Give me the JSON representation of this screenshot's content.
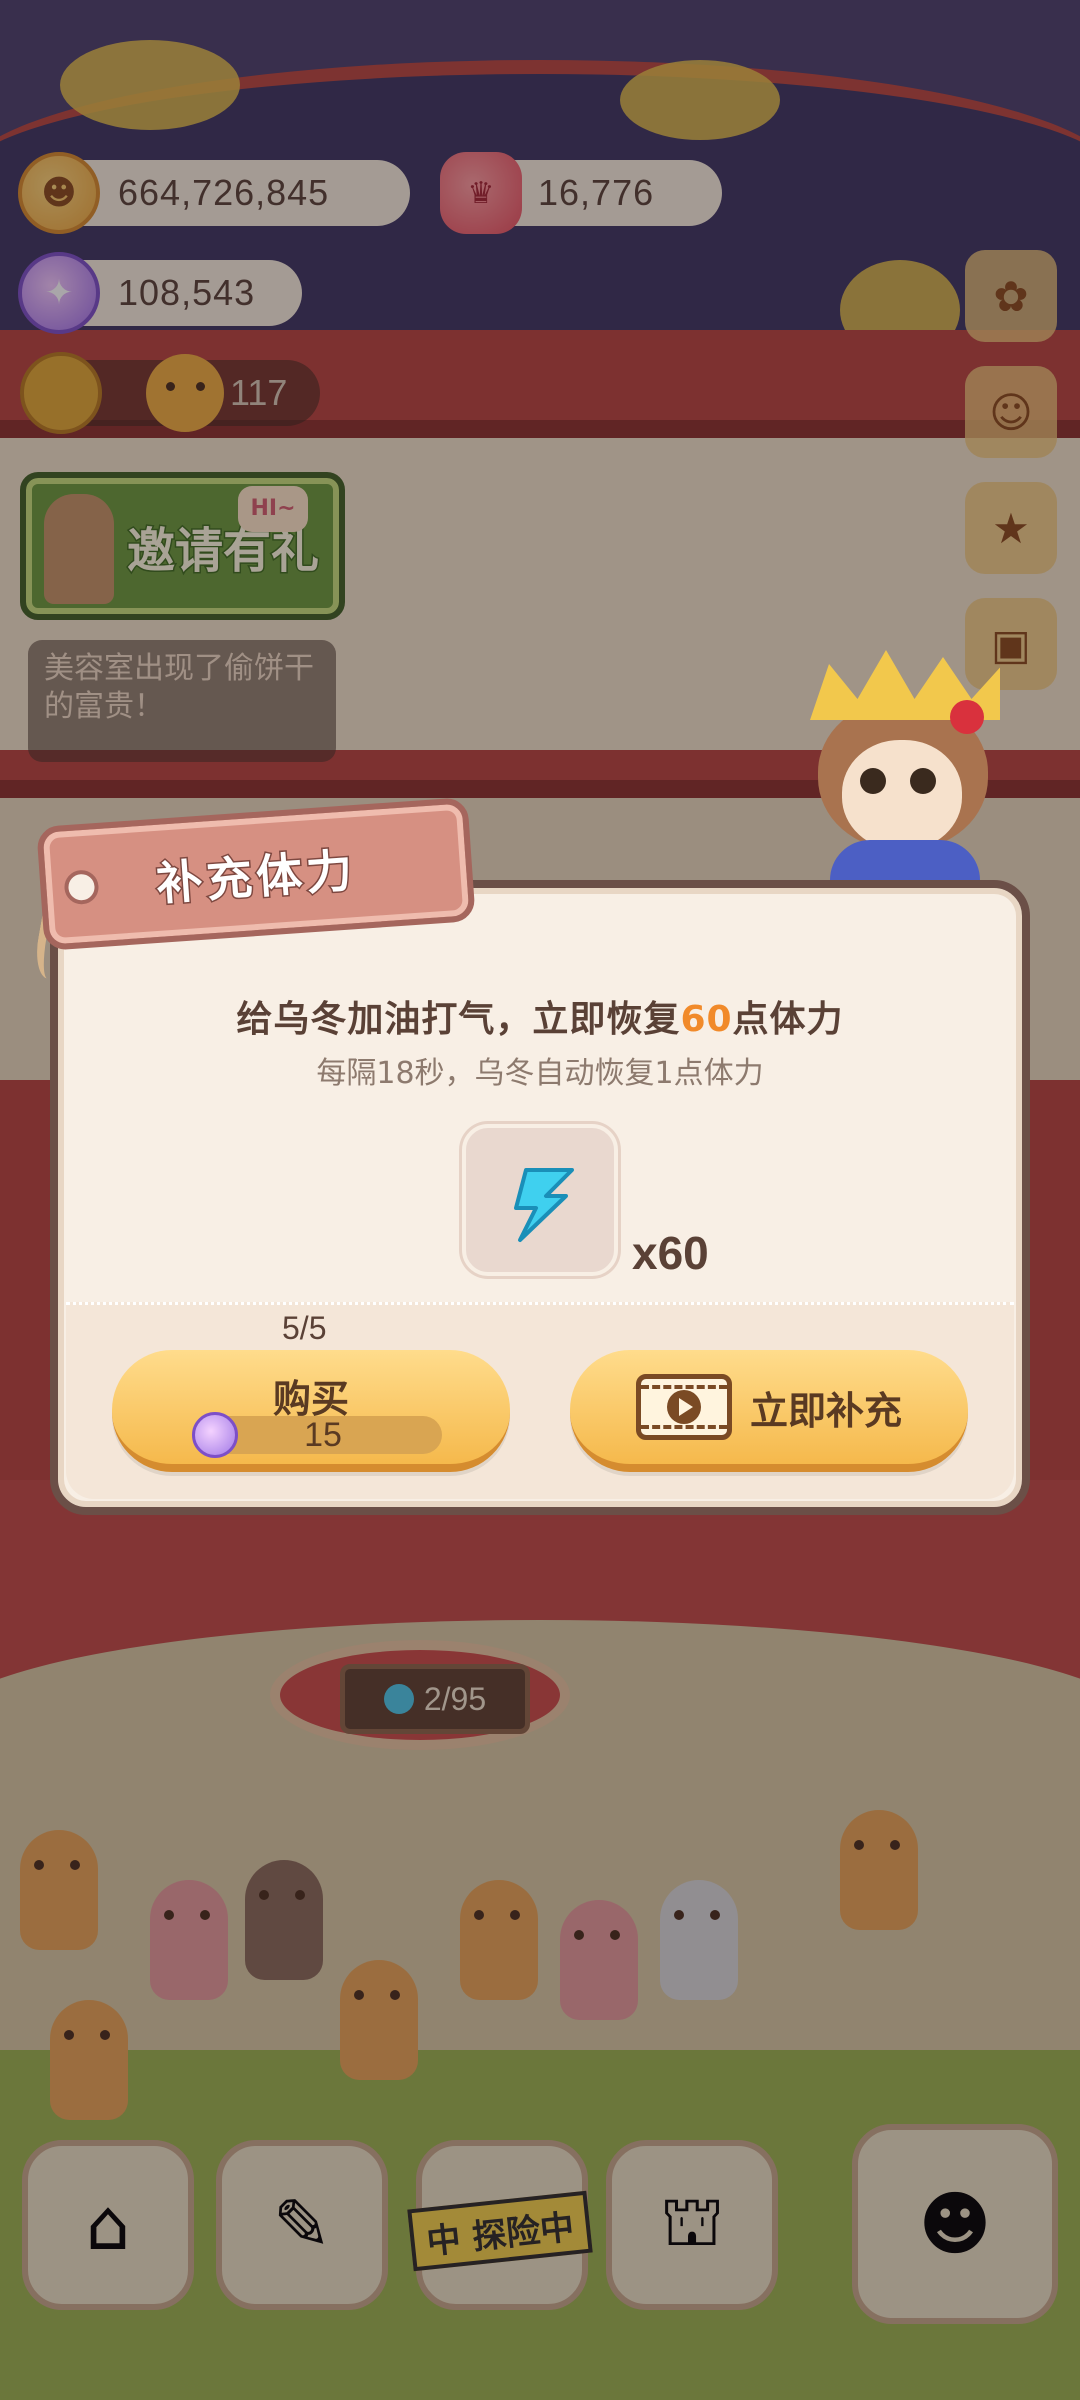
{
  "hud": {
    "coins": "664,726,845",
    "rubies": "16,776",
    "gems": "108,543",
    "gauge_value": "117"
  },
  "invite": {
    "label": "邀请有礼",
    "bubble": "HI~"
  },
  "notice": {
    "text": "美容室出现了偷饼干的富贵！"
  },
  "modal": {
    "title": "补充体力",
    "message_prefix": "给乌冬加油打气，立即恢复",
    "message_amount": "60",
    "message_suffix": "点体力",
    "subtext": "每隔18秒，乌冬自动恢复1点体力",
    "item_quantity": "x60",
    "purchase_limit": "5/5",
    "buy_button_label": "购买",
    "buy_price": "15",
    "refill_button_label": "立即补充"
  },
  "scene": {
    "counter_value": "2/95"
  },
  "nav": {
    "explore_label": "中 探险中"
  },
  "colors": {
    "highlight": "#f18a2a",
    "button": "#f5b94c",
    "modal_bg": "#f8efe5",
    "modal_border": "#6b4f47"
  }
}
